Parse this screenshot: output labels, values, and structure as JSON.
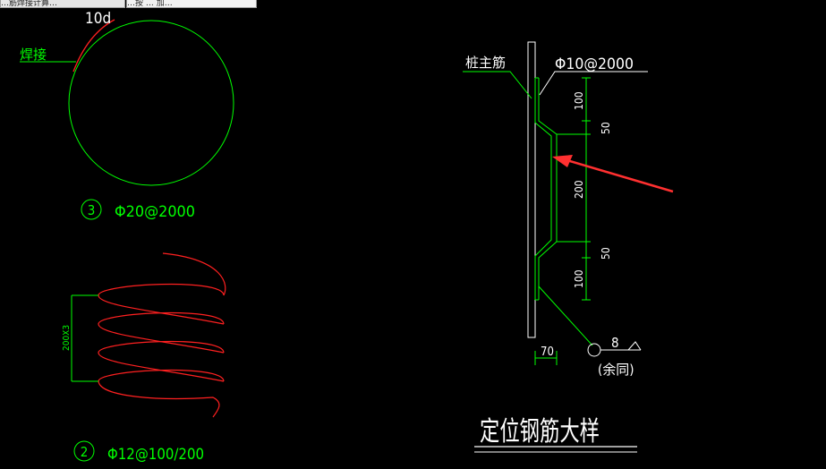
{
  "window": {
    "tabs": [
      {
        "label": "…筋焊接计算…"
      },
      {
        "label": "…按 … 加…"
      }
    ]
  },
  "drawing": {
    "ring": {
      "lap_label": "10d",
      "weld_label": "焊接",
      "number": "3",
      "spec": "Φ20@2000"
    },
    "spiral": {
      "dim_label": "200X3",
      "number": "2",
      "spec": "Φ12@100/200"
    },
    "detail": {
      "main_bar_label": "桩主筋",
      "spec": "Φ10@2000",
      "dims": [
        "100",
        "50",
        "200",
        "50",
        "100"
      ],
      "width_dim": "70",
      "bubble_value": "8",
      "bubble_note": "(余同)",
      "title": "定位钢筋大样"
    }
  },
  "colors": {
    "background": "#000000",
    "white": "#ffffff",
    "green": "#00ff00",
    "red": "#ff2020",
    "arrow": "#ff3030"
  }
}
